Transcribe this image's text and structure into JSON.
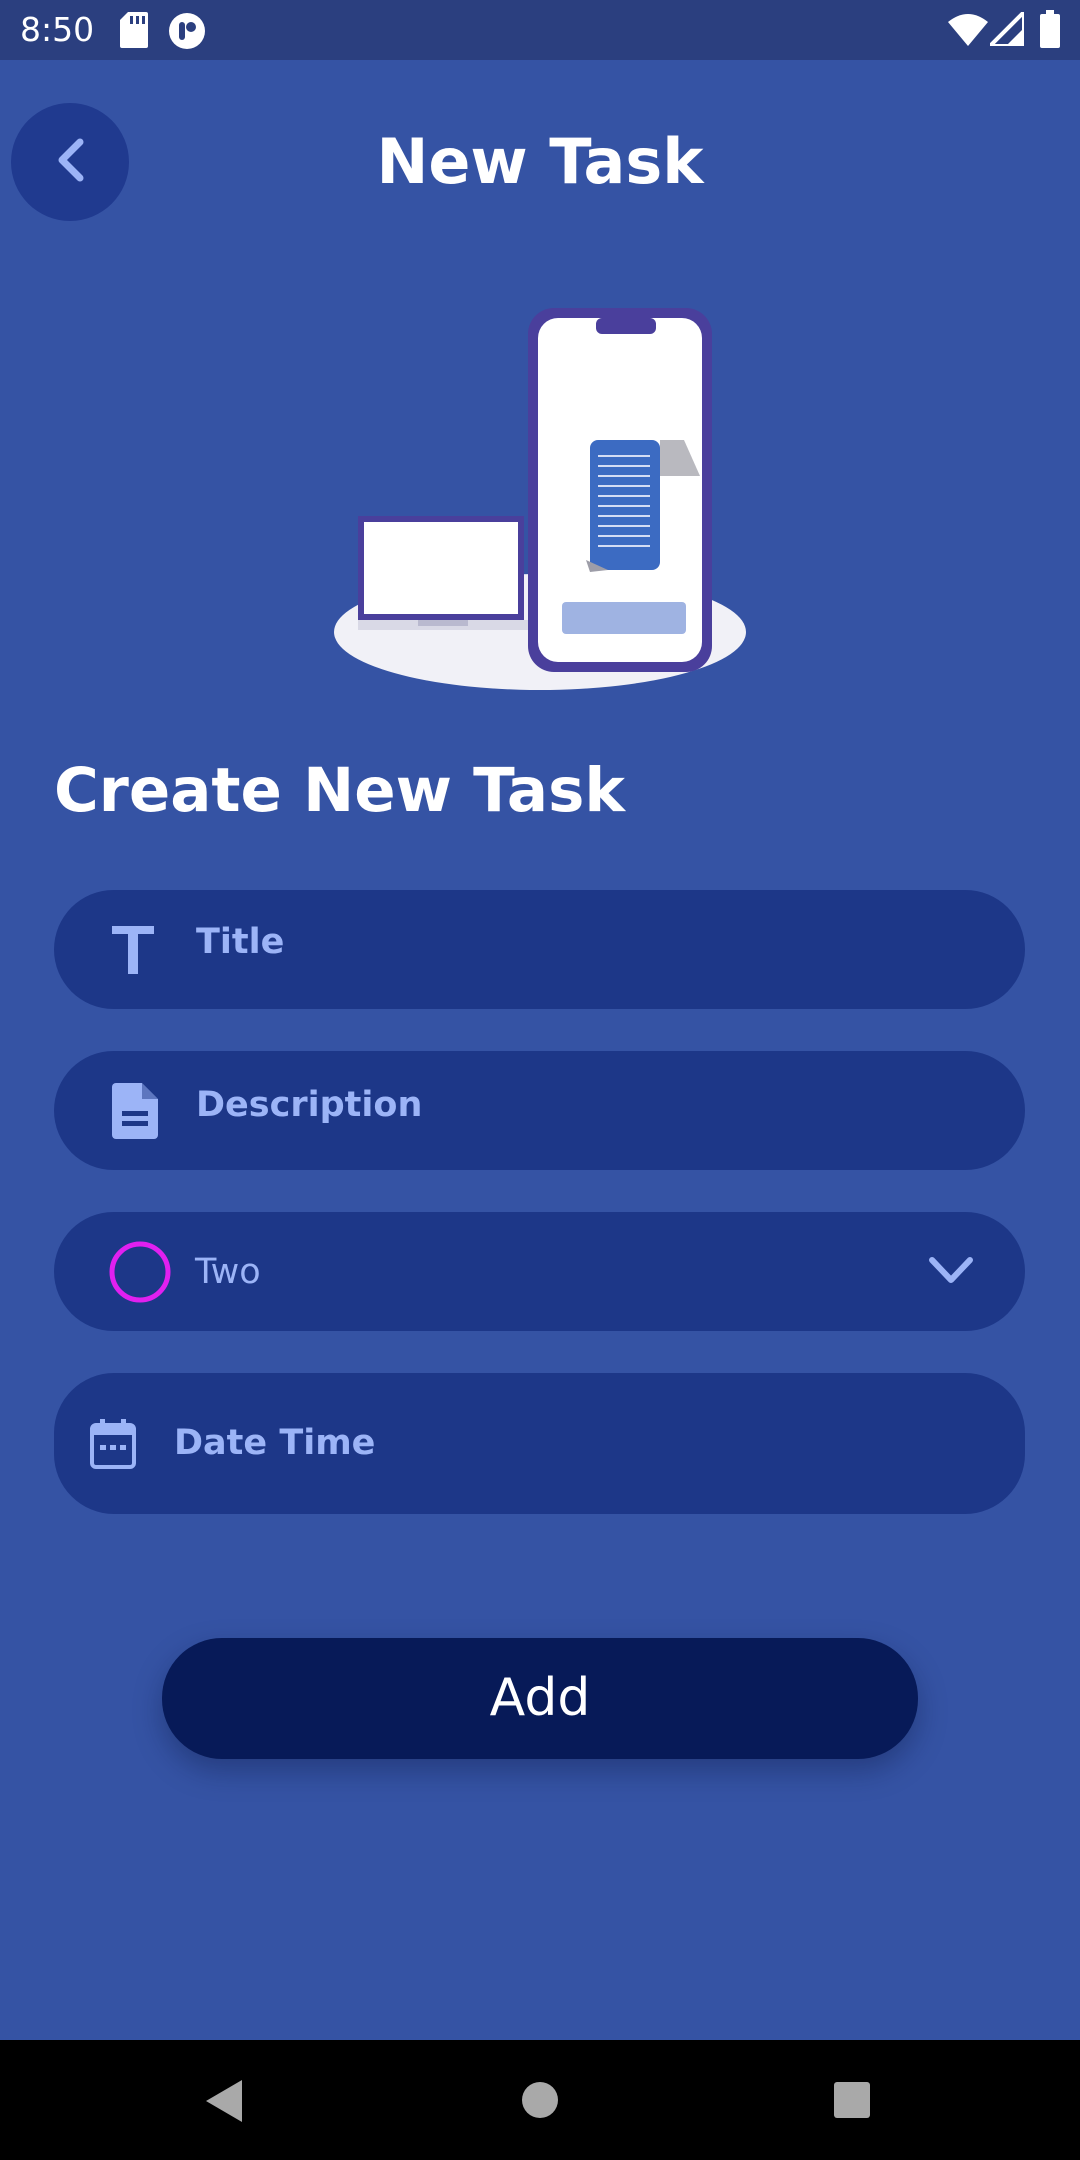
{
  "status_bar": {
    "time": "8:50",
    "icons": [
      "sd-card-icon",
      "app-notification-icon",
      "wifi-icon",
      "signal-icon",
      "battery-icon"
    ]
  },
  "app_bar": {
    "back_icon": "chevron-left-icon",
    "title": "New Task"
  },
  "illustration": {
    "description_icon": "phone-and-laptop-illustration"
  },
  "form": {
    "section_title": "Create New Task",
    "title_field": {
      "icon": "text-t-icon",
      "placeholder": "Title"
    },
    "description_field": {
      "icon": "document-icon",
      "placeholder": "Description"
    },
    "priority_select": {
      "icon": "circle-icon",
      "selected": "Two",
      "dropdown_icon": "chevron-down-icon",
      "indicator_color": "#e020f0"
    },
    "datetime_field": {
      "icon": "calendar-icon",
      "placeholder": "Date Time"
    },
    "submit_label": "Add"
  },
  "nav_bar": {
    "back_icon": "nav-back-icon",
    "home_icon": "nav-home-icon",
    "recents_icon": "nav-recents-icon"
  },
  "colors": {
    "background": "#3553a4",
    "field_background": "#1d3788",
    "field_text": "#9cb4f7",
    "button_background": "#071a58"
  }
}
